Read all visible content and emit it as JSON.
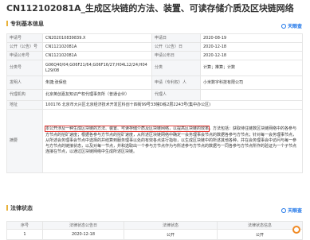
{
  "title": "CN112102081A_生成区块链的方法、装置、可读存储介质及区块链网络",
  "sections": {
    "basic_info": "专利基本信息",
    "legal_status": "法律状态"
  },
  "watermark": "天眼查",
  "info": {
    "app_no_label": "申请号",
    "app_no": "CN202010839839.X",
    "app_date_label": "申请日",
    "app_date": "2020-08-19",
    "pub_no_label": "公开（公告）号",
    "pub_no": "CN112102081A",
    "pub_date_label": "公开（公告）日",
    "pub_date": "2020-12-18",
    "app_pub_no_label": "申请公布号",
    "app_pub_no": "CN112102081A",
    "app_pub_date_label": "申请公布日",
    "app_pub_date": "2020-12-18",
    "class_no_label": "分类号",
    "class_no": "G06Q40/04;G06F21/64;G06F16/27;H04L12/24;H04L29/08",
    "class_label": "分类",
    "class": "计算；推算；计数",
    "inventor_label": "发明人",
    "inventor": "朱捷;张保佳",
    "applicant_label": "申请（专利权）人",
    "applicant": "小米数字科技有限公司",
    "agency_label": "代理机构",
    "agency": "北京英创嘉友知识产权代理事务所（普通合伙）",
    "agent_label": "代理人",
    "agent": "",
    "address_label": "地址",
    "address": "100176 北京市大兴区北京经济技术开发区科创十四街99号33幢D栋2层2243号(集中办公区)",
    "abstract_label": "摘要",
    "abstract_highlight": "本公开涉及一种生成区块链的方法、装置、可读存储介质及区块链网络，以提高区块链的效率",
    "abstract_rest": "，方法包括：获取待往链数区块链网络中的各参与方节点的挖矿速度；根据各参与方节点的挖矿速度，从所述区块链网络中确定一会务理事会节点的数据各参与方节点；针对每一会务理事节点，从所述会务理事会节点中选择的并结算到服务理事以处的有效各点进行指标，以生成区块链中的所述其他各种，并在会务理事会中访问与每一参与方节点的链接状态，以及对每一节点，并和选取出一个参与方节点作为与所述参与方节点的数据与一同各参与方节点所作的验证为一个子节点连接在节点，以通过区块链网络中生成所述区块链。"
  },
  "legal": {
    "headers": [
      "序号",
      "法律状态公告日",
      "法律状态",
      "法律状态信息"
    ],
    "rows": [
      {
        "no": "1",
        "date": "2020-12-18",
        "status": "公开",
        "info": "公开"
      }
    ]
  }
}
